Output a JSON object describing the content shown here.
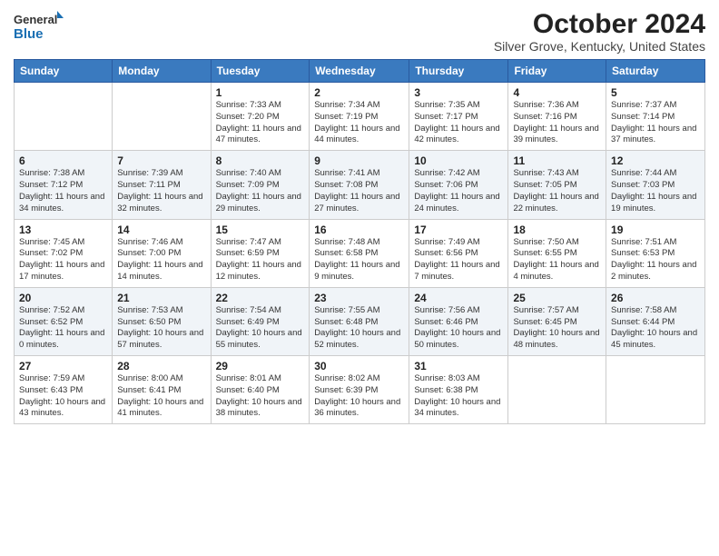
{
  "header": {
    "logo_line1": "General",
    "logo_line2": "Blue",
    "month_title": "October 2024",
    "subtitle": "Silver Grove, Kentucky, United States"
  },
  "days_of_week": [
    "Sunday",
    "Monday",
    "Tuesday",
    "Wednesday",
    "Thursday",
    "Friday",
    "Saturday"
  ],
  "weeks": [
    [
      {
        "day": "",
        "info": ""
      },
      {
        "day": "",
        "info": ""
      },
      {
        "day": "1",
        "info": "Sunrise: 7:33 AM\nSunset: 7:20 PM\nDaylight: 11 hours and 47 minutes."
      },
      {
        "day": "2",
        "info": "Sunrise: 7:34 AM\nSunset: 7:19 PM\nDaylight: 11 hours and 44 minutes."
      },
      {
        "day": "3",
        "info": "Sunrise: 7:35 AM\nSunset: 7:17 PM\nDaylight: 11 hours and 42 minutes."
      },
      {
        "day": "4",
        "info": "Sunrise: 7:36 AM\nSunset: 7:16 PM\nDaylight: 11 hours and 39 minutes."
      },
      {
        "day": "5",
        "info": "Sunrise: 7:37 AM\nSunset: 7:14 PM\nDaylight: 11 hours and 37 minutes."
      }
    ],
    [
      {
        "day": "6",
        "info": "Sunrise: 7:38 AM\nSunset: 7:12 PM\nDaylight: 11 hours and 34 minutes."
      },
      {
        "day": "7",
        "info": "Sunrise: 7:39 AM\nSunset: 7:11 PM\nDaylight: 11 hours and 32 minutes."
      },
      {
        "day": "8",
        "info": "Sunrise: 7:40 AM\nSunset: 7:09 PM\nDaylight: 11 hours and 29 minutes."
      },
      {
        "day": "9",
        "info": "Sunrise: 7:41 AM\nSunset: 7:08 PM\nDaylight: 11 hours and 27 minutes."
      },
      {
        "day": "10",
        "info": "Sunrise: 7:42 AM\nSunset: 7:06 PM\nDaylight: 11 hours and 24 minutes."
      },
      {
        "day": "11",
        "info": "Sunrise: 7:43 AM\nSunset: 7:05 PM\nDaylight: 11 hours and 22 minutes."
      },
      {
        "day": "12",
        "info": "Sunrise: 7:44 AM\nSunset: 7:03 PM\nDaylight: 11 hours and 19 minutes."
      }
    ],
    [
      {
        "day": "13",
        "info": "Sunrise: 7:45 AM\nSunset: 7:02 PM\nDaylight: 11 hours and 17 minutes."
      },
      {
        "day": "14",
        "info": "Sunrise: 7:46 AM\nSunset: 7:00 PM\nDaylight: 11 hours and 14 minutes."
      },
      {
        "day": "15",
        "info": "Sunrise: 7:47 AM\nSunset: 6:59 PM\nDaylight: 11 hours and 12 minutes."
      },
      {
        "day": "16",
        "info": "Sunrise: 7:48 AM\nSunset: 6:58 PM\nDaylight: 11 hours and 9 minutes."
      },
      {
        "day": "17",
        "info": "Sunrise: 7:49 AM\nSunset: 6:56 PM\nDaylight: 11 hours and 7 minutes."
      },
      {
        "day": "18",
        "info": "Sunrise: 7:50 AM\nSunset: 6:55 PM\nDaylight: 11 hours and 4 minutes."
      },
      {
        "day": "19",
        "info": "Sunrise: 7:51 AM\nSunset: 6:53 PM\nDaylight: 11 hours and 2 minutes."
      }
    ],
    [
      {
        "day": "20",
        "info": "Sunrise: 7:52 AM\nSunset: 6:52 PM\nDaylight: 11 hours and 0 minutes."
      },
      {
        "day": "21",
        "info": "Sunrise: 7:53 AM\nSunset: 6:50 PM\nDaylight: 10 hours and 57 minutes."
      },
      {
        "day": "22",
        "info": "Sunrise: 7:54 AM\nSunset: 6:49 PM\nDaylight: 10 hours and 55 minutes."
      },
      {
        "day": "23",
        "info": "Sunrise: 7:55 AM\nSunset: 6:48 PM\nDaylight: 10 hours and 52 minutes."
      },
      {
        "day": "24",
        "info": "Sunrise: 7:56 AM\nSunset: 6:46 PM\nDaylight: 10 hours and 50 minutes."
      },
      {
        "day": "25",
        "info": "Sunrise: 7:57 AM\nSunset: 6:45 PM\nDaylight: 10 hours and 48 minutes."
      },
      {
        "day": "26",
        "info": "Sunrise: 7:58 AM\nSunset: 6:44 PM\nDaylight: 10 hours and 45 minutes."
      }
    ],
    [
      {
        "day": "27",
        "info": "Sunrise: 7:59 AM\nSunset: 6:43 PM\nDaylight: 10 hours and 43 minutes."
      },
      {
        "day": "28",
        "info": "Sunrise: 8:00 AM\nSunset: 6:41 PM\nDaylight: 10 hours and 41 minutes."
      },
      {
        "day": "29",
        "info": "Sunrise: 8:01 AM\nSunset: 6:40 PM\nDaylight: 10 hours and 38 minutes."
      },
      {
        "day": "30",
        "info": "Sunrise: 8:02 AM\nSunset: 6:39 PM\nDaylight: 10 hours and 36 minutes."
      },
      {
        "day": "31",
        "info": "Sunrise: 8:03 AM\nSunset: 6:38 PM\nDaylight: 10 hours and 34 minutes."
      },
      {
        "day": "",
        "info": ""
      },
      {
        "day": "",
        "info": ""
      }
    ]
  ]
}
